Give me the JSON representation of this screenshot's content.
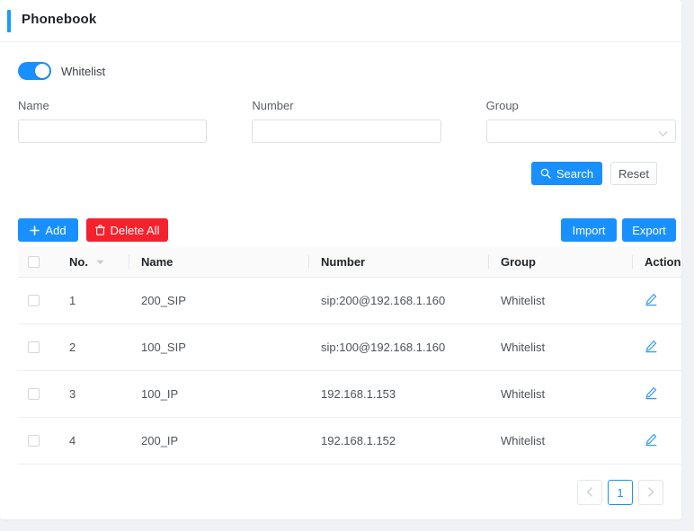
{
  "header": {
    "title": "Phonebook",
    "accent_color": "#1c9cf6"
  },
  "toggle": {
    "label": "Whitelist",
    "state": "on",
    "color": "#1890ff"
  },
  "search_form": {
    "fields": [
      {
        "label": "Name",
        "value": "",
        "placeholder": "",
        "type": "text"
      },
      {
        "label": "Number",
        "value": "",
        "placeholder": "",
        "type": "text"
      },
      {
        "label": "Group",
        "value": "",
        "placeholder": "",
        "type": "select"
      }
    ],
    "search_label": "Search",
    "reset_label": "Reset",
    "search_icon": "search-icon",
    "primary_color": "#1890ff"
  },
  "action_bar": {
    "add_label": "Add",
    "add_icon": "plus-icon",
    "delete_all_label": "Delete All",
    "delete_all_icon": "trash-icon",
    "delete_color": "#f5222d",
    "import_label": "Import",
    "export_label": "Export"
  },
  "table": {
    "columns": [
      {
        "label": ""
      },
      {
        "label": "No."
      },
      {
        "label": "Name"
      },
      {
        "label": "Number"
      },
      {
        "label": "Group"
      },
      {
        "label": "Action"
      }
    ],
    "sort_icon": "caret-down-icon",
    "row_action_icon": "edit-pencil-icon",
    "rows": [
      {
        "no": "1",
        "name": "200_SIP",
        "number": "sip:200@192.168.1.160",
        "group": "Whitelist"
      },
      {
        "no": "2",
        "name": "100_SIP",
        "number": "sip:100@192.168.1.160",
        "group": "Whitelist"
      },
      {
        "no": "3",
        "name": "100_IP",
        "number": "192.168.1.153",
        "group": "Whitelist"
      },
      {
        "no": "4",
        "name": "200_IP",
        "number": "192.168.1.152",
        "group": "Whitelist"
      }
    ]
  },
  "pagination": {
    "prev_icon": "chevron-left-icon",
    "next_icon": "chevron-right-icon",
    "current_page": "1",
    "pages": [
      "1"
    ],
    "active_color": "#1890ff"
  }
}
